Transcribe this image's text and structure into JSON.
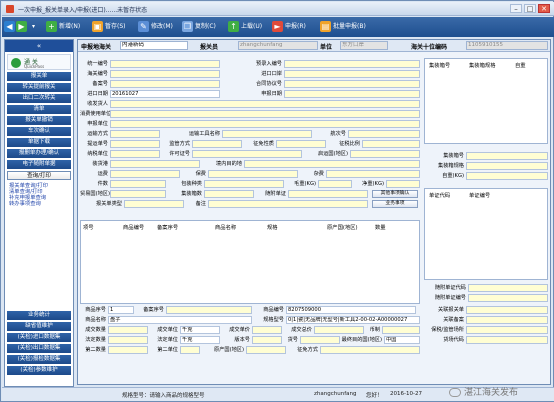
{
  "window": {
    "title": "一次申报_报关单录入/申报(进口)......未暂存状态",
    "min": "–",
    "max": "□",
    "close": "✕"
  },
  "toolbar": [
    {
      "label": "新增(N)",
      "color": "#3fae44",
      "icon": "plus-icon",
      "glyph": "+"
    },
    {
      "label": "暂存(S)",
      "color": "#f0a32b",
      "icon": "save-icon",
      "glyph": "▣"
    },
    {
      "label": "修改(M)",
      "color": "#5b8ed6",
      "icon": "edit-icon",
      "glyph": "✎"
    },
    {
      "label": "复制(C)",
      "color": "#7aa6e0",
      "icon": "copy-icon",
      "glyph": "❐"
    },
    {
      "label": "上载(U)",
      "color": "#3fae44",
      "icon": "upload-icon",
      "glyph": "↑"
    },
    {
      "label": "申报(R)",
      "color": "#e04a3a",
      "icon": "declare-icon",
      "glyph": "►"
    },
    {
      "label": "批量申报(B)",
      "color": "#f0a32b",
      "icon": "batch-icon",
      "glyph": "▤"
    }
  ],
  "sidebar": {
    "logo": "通 关",
    "logo_sub": "QuickPass",
    "items": [
      "报关单",
      "转关提前报关",
      "出口二次转关",
      "清单",
      "报关单撤销",
      "车次确认",
      "单据下载",
      "报删单办理/确认",
      "电子随附单据",
      "查询/打印"
    ],
    "sub_items": [
      "报关单查询/打印",
      "清单查询/打印",
      "补充申报单查询",
      "转办事项查询"
    ],
    "bottom_items": [
      "业务统计",
      "缺省值维护",
      "(关检)进口数据集",
      "(关检)出口数据集",
      "(关检)报检数据集",
      "(关检)参数维护"
    ]
  },
  "form": {
    "header": {
      "l1": "申报地海关",
      "v1": "内港新码",
      "l2": "报关员",
      "v2": "zhangchunfang",
      "l3": "单位",
      "v3": "东方口岸",
      "l4": "海关十位编码",
      "v4": "1105910155"
    },
    "r1": {
      "a": "统一编号",
      "b": "预录入编号"
    },
    "r2": {
      "a": "海关编号",
      "b": "进口口岸"
    },
    "r3": {
      "a": "备案号",
      "b": "合同协议号"
    },
    "r4": {
      "a": "进口日期",
      "va": "20161027",
      "b": "申报日期"
    },
    "r5": {
      "a": "收发货人"
    },
    "r6": {
      "a": "消费使用单位"
    },
    "r7": {
      "a": "申报单位"
    },
    "r8": {
      "a": "运输方式",
      "b": "运输工具名称",
      "c": "航次号"
    },
    "r9": {
      "a": "提运单号",
      "b": "监管方式",
      "c": "征免性质",
      "d": "征税比例"
    },
    "r10": {
      "a": "纳税单位",
      "b": "许可证号",
      "c": "启运国(地区)"
    },
    "r11": {
      "a": "装货港",
      "b": "境内目的地"
    },
    "r12": {
      "a": "运费",
      "b": "保费",
      "c": "杂费"
    },
    "r13": {
      "a": "件数",
      "b": "包装种类",
      "c": "毛重(KG)",
      "d": "净重(KG)"
    },
    "r14": {
      "a": "贸易国(地区)",
      "b": "集装箱数",
      "c": "随附单证",
      "btn": "其他事项确认"
    },
    "r15": {
      "a": "报关单类型",
      "b": "备注",
      "btn": "业务事项"
    },
    "container": {
      "h1": "集装箱号",
      "h2": "集装箱规格",
      "h3": "自重",
      "f1": "集装箱号",
      "f2": "集装箱规格",
      "f3": "自重(KG)"
    },
    "license": {
      "h1": "单证代码",
      "h2": "单证编号",
      "f1": "随附单证代码",
      "f2": "随附单证编号"
    },
    "goods_cols": [
      "项号",
      "商品编号",
      "备案序号",
      "商品名称",
      "规格",
      "原产国(地区)",
      "数量"
    ],
    "goods": {
      "r1": {
        "a": "商品序号",
        "va": "1",
        "b": "备案序号",
        "c": "商品编号",
        "vc": "8207509000"
      },
      "r2": {
        "a": "商品名称",
        "va": "盘子",
        "b": "规格型号",
        "vb": "0|1|瓷|无品牌|无型号|新工具2-00-02-A00000027"
      },
      "r3": {
        "a": "成交数量",
        "b": "成交单位",
        "vb": "千克",
        "c": "成交单价",
        "d": "成交总价",
        "e": "币制"
      },
      "r4": {
        "a": "法定数量",
        "b": "法定单位",
        "vb": "千克",
        "c": "版本号",
        "d": "货号",
        "e": "最终目的国(地区)",
        "ve": "中国"
      },
      "r5": {
        "a": "第二数量",
        "b": "第二单位",
        "c": "原产国(地区)",
        "d": "征免方式"
      },
      "side": [
        "关联报关单",
        "关联备案",
        "保税/监管场所",
        "货场代码"
      ]
    }
  },
  "status": {
    "msg": "规格型号：请输入商品的规格型号",
    "user": "zhangchunfang",
    "hello": "您好！",
    "date": "2016-10-27"
  },
  "watermark": "湛江海关发布"
}
